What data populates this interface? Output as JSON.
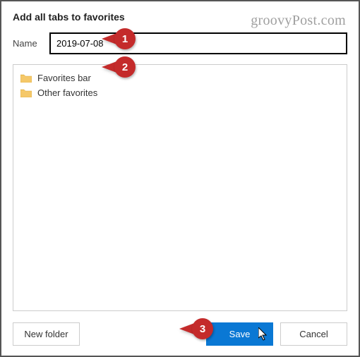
{
  "dialog": {
    "title": "Add all tabs to favorites",
    "name_label": "Name",
    "name_value": "2019-07-08"
  },
  "folders": [
    {
      "label": "Favorites bar"
    },
    {
      "label": "Other favorites"
    }
  ],
  "buttons": {
    "new_folder": "New folder",
    "save": "Save",
    "cancel": "Cancel"
  },
  "watermark": "groovyPost.com",
  "annotations": {
    "one": "1",
    "two": "2",
    "three": "3"
  },
  "colors": {
    "primary": "#0a78d4",
    "annotation": "#c42b2b"
  }
}
